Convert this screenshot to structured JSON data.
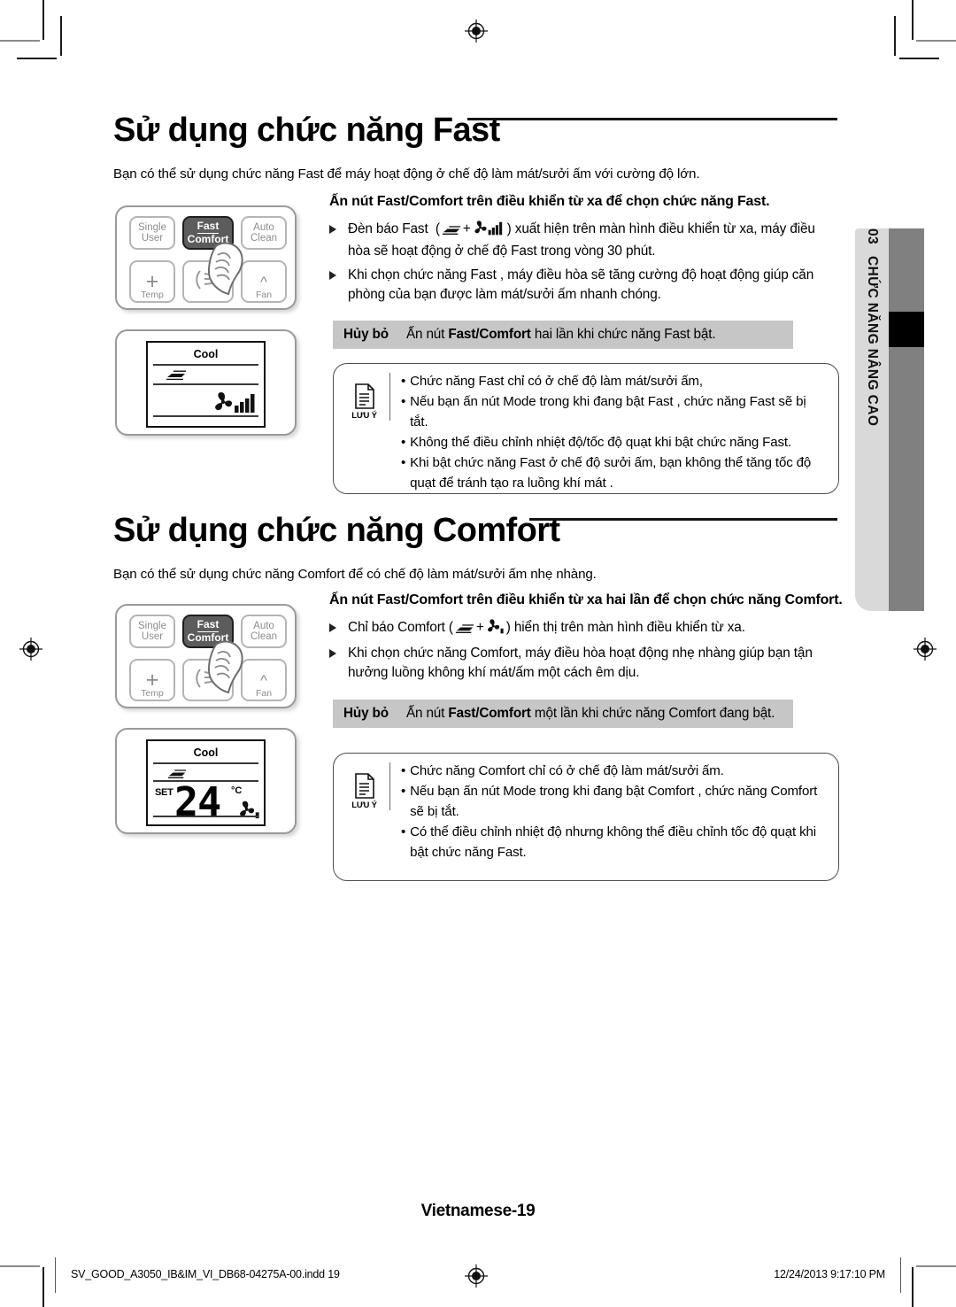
{
  "side_tab": {
    "number": "03",
    "title": "CHỨC NĂNG NÂNG CAO"
  },
  "sections": [
    {
      "heading": "Sử dụng chức năng Fast",
      "intro": "Bạn có thể sử dụng chức năng Fast để máy hoạt động ở chế độ làm mát/sưởi ấm với cường độ lớn.",
      "lead": "Ấn nút Fast/Comfort  trên điều khiển từ xa để chọn chức năng Fast.",
      "bullets": [
        "Đèn báo Fast  (  +  ) xuất hiện trên màn hình điều khiển từ xa, máy điều hòa sẽ hoạt động ở chế độ Fast trong vòng 30 phút.",
        "Khi chọn chức năng Fast , máy điều hòa sẽ tăng cường độ hoạt động giúp căn phòng của bạn được làm mát/sưởi ấm nhanh chóng."
      ],
      "cancel": {
        "label": "Hủy bỏ",
        "prefix": "Ấn nút ",
        "bold": "Fast/Comfort",
        "suffix": " hai lần khi chức năng Fast bật."
      },
      "note": {
        "icon_word": "LƯU Ý",
        "items": [
          "Chức năng Fast chỉ có ở chế độ làm mát/sưởi ấm,",
          "Nếu bạn ấn nút Mode trong khi đang bật Fast , chức năng Fast  sẽ bị tắt.",
          "Không thể điều chỉnh nhiệt độ/tốc độ quạt khi bật chức năng Fast.",
          "Khi bật chức năng Fast  ở chế độ sưởi ấm, bạn không thể tăng tốc độ quạt để tránh tạo ra luồng khí mát ."
        ]
      },
      "display": {
        "mode": "Cool",
        "set_label": "",
        "temperature": "",
        "unit": "",
        "fan_bars": 4
      }
    },
    {
      "heading": "Sử dụng chức năng Comfort",
      "intro": "Bạn có thể sử dụng chức năng Comfort  để có chế độ làm mát/sưởi ấm nhẹ nhàng.",
      "lead": "Ấn nút Fast/Comfort trên điều khiển từ xa hai lần để chọn chức năng Comfort.",
      "bullets": [
        "Chỉ báo Comfort (  +  ) hiển thị trên màn hình điều khiển từ xa.",
        "Khi chọn chức năng Comfort, máy điều hòa hoạt động nhẹ nhàng giúp bạn tận hưởng luồng không khí mát/ấm một cách êm dịu."
      ],
      "cancel": {
        "label": "Hủy bỏ",
        "prefix": "Ấn nút ",
        "bold": "Fast/Comfort",
        "suffix": " một lần khi chức năng Comfort đang bật."
      },
      "note": {
        "icon_word": "LƯU Ý",
        "items": [
          "Chức năng Comfort  chỉ có ở chế độ làm mát/sưởi ấm.",
          "Nếu bạn ấn nút Mode trong khi đang bật Comfort , chức năng Comfort sẽ bị tắt.",
          "Có thể điều chỉnh nhiệt độ nhưng không thể điều chỉnh tốc độ quạt khi bật chức năng Fast."
        ]
      },
      "display": {
        "mode": "Cool",
        "set_label": "SET",
        "temperature": "24",
        "unit": "°C",
        "fan_bars": 1
      }
    }
  ],
  "remote": {
    "keys": {
      "single_user_line1": "Single",
      "single_user_line2": "User",
      "fast_line1": "Fast",
      "fast_line2": "Comfort",
      "auto_clean_line1": "Auto",
      "auto_clean_line2": "Clean",
      "plus": "+",
      "temp_label": "Temp",
      "fan_label": "Fan"
    }
  },
  "footer": {
    "page_label": "Vietnamese-19",
    "file_name": "SV_GOOD_A3050_IB&IM_VI_DB68-04275A-00.indd   19",
    "timestamp": "12/24/2013   9:17:10 PM"
  },
  "colors": {
    "tab_light": "#d9d9d9",
    "tab_strip": "#808080",
    "cancel_bar": "#c6c6c6",
    "key_dark": "#5c5c5c"
  }
}
